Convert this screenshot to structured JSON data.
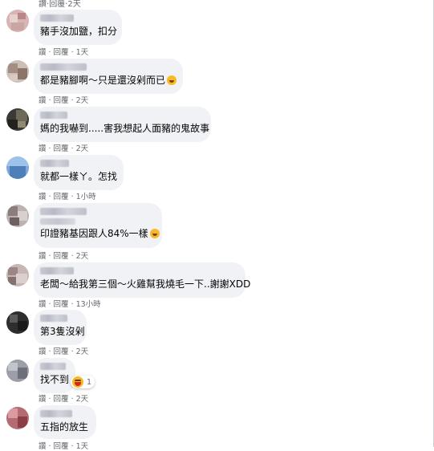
{
  "labels": {
    "like": "讚",
    "reply": "回覆",
    "separator": "·"
  },
  "top_meta": {
    "time": "2天"
  },
  "comments": [
    {
      "text": "豬手沒加鹽，扣分",
      "emoji": "",
      "time": "1天",
      "reaction_count": ""
    },
    {
      "text": "都是豬腳啊～只是還沒剁而已",
      "emoji": "rolling-laugh-emoji",
      "time": "2天",
      "reaction_count": ""
    },
    {
      "text": "媽的我嚇到.....害我想起人面豬的鬼故事",
      "emoji": "",
      "time": "2天",
      "reaction_count": ""
    },
    {
      "text": "就都一樣ㄚ。怎找",
      "emoji": "",
      "time": "1小時",
      "reaction_count": ""
    },
    {
      "text": "印證豬基因跟人84%一樣",
      "emoji": "grin-emoji",
      "time": "2天",
      "reaction_count": ""
    },
    {
      "text": "老闆～給我第三個～火雞幫我燒毛一下..謝謝XDD",
      "emoji": "",
      "time": "13小時",
      "reaction_count": ""
    },
    {
      "text": "第3隻沒剁",
      "emoji": "",
      "time": "2天",
      "reaction_count": ""
    },
    {
      "text": "找不到",
      "emoji": "",
      "time": "2天",
      "reaction_count": "1"
    },
    {
      "text": "五指的放生",
      "emoji": "",
      "time": "1天",
      "reaction_count": ""
    }
  ]
}
